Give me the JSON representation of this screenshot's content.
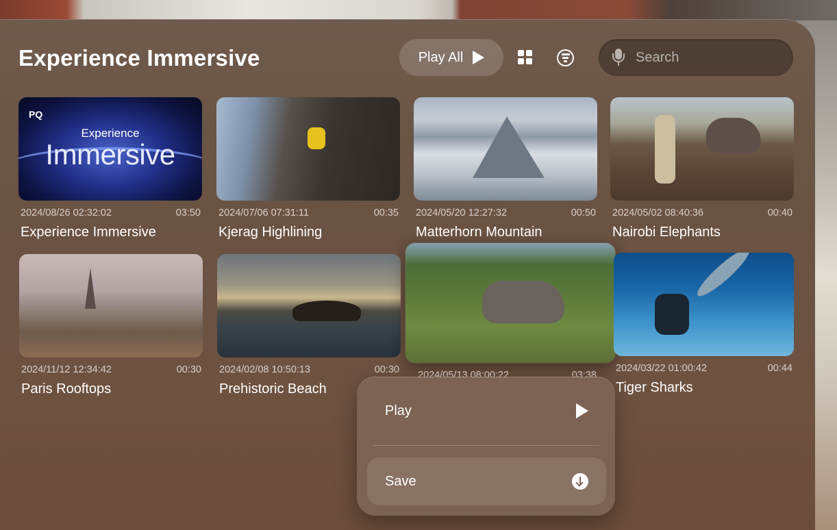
{
  "header": {
    "title": "Experience Immersive",
    "play_all_label": "Play All",
    "grid_icon": "grid-icon",
    "filter_icon": "filter-icon",
    "search": {
      "placeholder": "Search",
      "icon": "microphone-icon"
    }
  },
  "thumbnail_text": {
    "experience": {
      "badge": "PQ",
      "line1": "Experience",
      "line2": "Immersive"
    }
  },
  "videos": [
    {
      "date": "2024/08/26 02:32:02",
      "duration": "03:50",
      "title": "Experience Immersive"
    },
    {
      "date": "2024/07/06 07:31:11",
      "duration": "00:35",
      "title": "Kjerag Highlining"
    },
    {
      "date": "2024/05/20 12:27:32",
      "duration": "00:50",
      "title": "Matterhorn Mountain"
    },
    {
      "date": "2024/05/02 08:40:36",
      "duration": "00:40",
      "title": "Nairobi Elephants"
    },
    {
      "date": "2024/11/12 12:34:42",
      "duration": "00:30",
      "title": "Paris Rooftops"
    },
    {
      "date": "2024/02/08 10:50:13",
      "duration": "00:30",
      "title": "Prehistoric Beach"
    },
    {
      "date": "2024/05/13 08:00:22",
      "duration": "03:38",
      "title": ""
    },
    {
      "date": "2024/03/22 01:00:42",
      "duration": "00:44",
      "title": "Tiger Sharks"
    }
  ],
  "context_menu": {
    "play_label": "Play",
    "play_icon": "play-icon",
    "save_label": "Save",
    "save_icon": "download-icon"
  }
}
